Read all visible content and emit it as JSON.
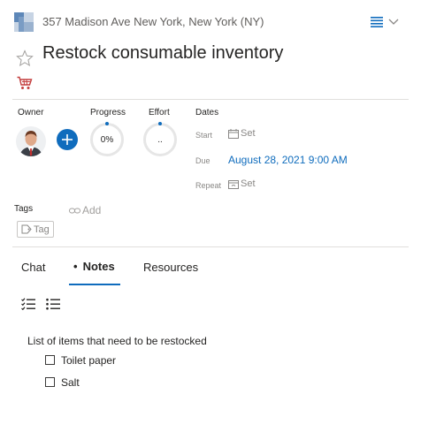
{
  "header": {
    "location": "357 Madison Ave New York, New York (NY)",
    "menu_icon": "hamburger-icon",
    "chevron_icon": "chevron-down-icon"
  },
  "task": {
    "title": "Restock consumable inventory",
    "starred": false,
    "category_icon": "shopping-cart-icon"
  },
  "properties": {
    "owner_label": "Owner",
    "progress_label": "Progress",
    "progress_value": "0%",
    "effort_label": "Effort",
    "effort_value": "..",
    "dates_label": "Dates",
    "start_label": "Start",
    "start_value": "Set",
    "due_label": "Due",
    "due_value": "August 28, 2021 9:00 AM",
    "repeat_label": "Repeat",
    "repeat_value": "Set"
  },
  "tags": {
    "label": "Tags",
    "add_label": "Add",
    "tag_label": "Tag"
  },
  "tabs": [
    {
      "label": "Chat",
      "active": false
    },
    {
      "label": "Notes",
      "active": true,
      "bullet": "•"
    },
    {
      "label": "Resources",
      "active": false
    }
  ],
  "notes": {
    "intro": "List of items that need to be restocked",
    "items": [
      {
        "label": "Toilet paper",
        "checked": false
      },
      {
        "label": "Salt",
        "checked": false
      }
    ]
  },
  "colors": {
    "accent": "#0f6cbd",
    "cart": "#c43e3e",
    "divider": "#e1dfdd"
  }
}
